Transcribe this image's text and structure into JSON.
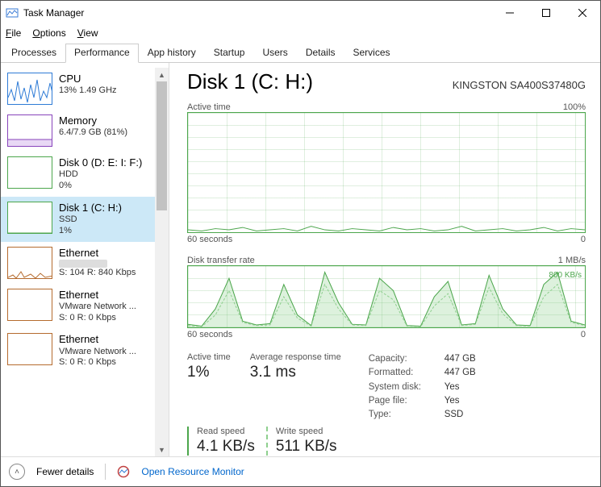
{
  "window": {
    "title": "Task Manager"
  },
  "menu": {
    "file": "File",
    "options": "Options",
    "view": "View"
  },
  "tabs": {
    "processes": "Processes",
    "performance": "Performance",
    "app_history": "App history",
    "startup": "Startup",
    "users": "Users",
    "details": "Details",
    "services": "Services"
  },
  "sidebar": {
    "items": [
      {
        "title": "CPU",
        "line2": "13%  1.49 GHz",
        "line3": "",
        "color": "#2e7bd6"
      },
      {
        "title": "Memory",
        "line2": "6.4/7.9 GB (81%)",
        "line3": "",
        "color": "#8844bb"
      },
      {
        "title": "Disk 0 (D: E: I: F:)",
        "line2": "HDD",
        "line3": "0%",
        "color": "#4ca64c"
      },
      {
        "title": "Disk 1 (C: H:)",
        "line2": "SSD",
        "line3": "1%",
        "color": "#4ca64c"
      },
      {
        "title": "Ethernet",
        "line2": "",
        "line3": "S: 104  R: 840 Kbps",
        "color": "#b56b2e"
      },
      {
        "title": "Ethernet",
        "line2": "VMware Network ...",
        "line3": "S: 0  R: 0 Kbps",
        "color": "#b56b2e"
      },
      {
        "title": "Ethernet",
        "line2": "VMware Network ...",
        "line3": "S: 0  R: 0 Kbps",
        "color": "#b56b2e"
      }
    ]
  },
  "detail": {
    "title": "Disk 1 (C: H:)",
    "model": "KINGSTON SA400S37480G",
    "chart1": {
      "title": "Active time",
      "max": "100%",
      "xleft": "60 seconds",
      "xright": "0"
    },
    "chart2": {
      "title": "Disk transfer rate",
      "max": "1 MB/s",
      "ann": "800 KB/s",
      "xleft": "60 seconds",
      "xright": "0"
    },
    "stats": {
      "active_time": {
        "label": "Active time",
        "value": "1%"
      },
      "avg_resp": {
        "label": "Average response time",
        "value": "3.1 ms"
      },
      "read": {
        "label": "Read speed",
        "value": "4.1 KB/s"
      },
      "write": {
        "label": "Write speed",
        "value": "511 KB/s"
      }
    },
    "props": {
      "capacity": {
        "k": "Capacity:",
        "v": "447 GB"
      },
      "formatted": {
        "k": "Formatted:",
        "v": "447 GB"
      },
      "systemdisk": {
        "k": "System disk:",
        "v": "Yes"
      },
      "pagefile": {
        "k": "Page file:",
        "v": "Yes"
      },
      "type": {
        "k": "Type:",
        "v": "SSD"
      }
    }
  },
  "footer": {
    "fewer": "Fewer details",
    "orm": "Open Resource Monitor"
  },
  "chart_data": [
    {
      "type": "line",
      "title": "Active time",
      "ylabel": "%",
      "ylim": [
        0,
        100
      ],
      "xlabel": "seconds",
      "xlim": [
        60,
        0
      ],
      "series": [
        {
          "name": "Active time %",
          "values": [
            2,
            1,
            3,
            2,
            4,
            1,
            2,
            3,
            1,
            5,
            2,
            1,
            3,
            2,
            1,
            4,
            2,
            3,
            1,
            2,
            5,
            1,
            2,
            3,
            1,
            2,
            4,
            1,
            3,
            2
          ]
        }
      ]
    },
    {
      "type": "line",
      "title": "Disk transfer rate",
      "ylabel": "KB/s",
      "ylim": [
        0,
        1000
      ],
      "xlabel": "seconds",
      "xlim": [
        60,
        0
      ],
      "annotation": "800 KB/s",
      "series": [
        {
          "name": "Read",
          "values": [
            50,
            20,
            300,
            800,
            100,
            40,
            60,
            700,
            200,
            30,
            900,
            400,
            50,
            40,
            800,
            600,
            30,
            20,
            500,
            750,
            40,
            60,
            850,
            300,
            40,
            30,
            700,
            900,
            100,
            40
          ]
        },
        {
          "name": "Write",
          "values": [
            30,
            10,
            200,
            600,
            80,
            30,
            40,
            500,
            150,
            20,
            700,
            300,
            40,
            30,
            600,
            450,
            20,
            10,
            350,
            550,
            30,
            50,
            650,
            220,
            30,
            20,
            500,
            700,
            80,
            30
          ]
        }
      ]
    }
  ]
}
